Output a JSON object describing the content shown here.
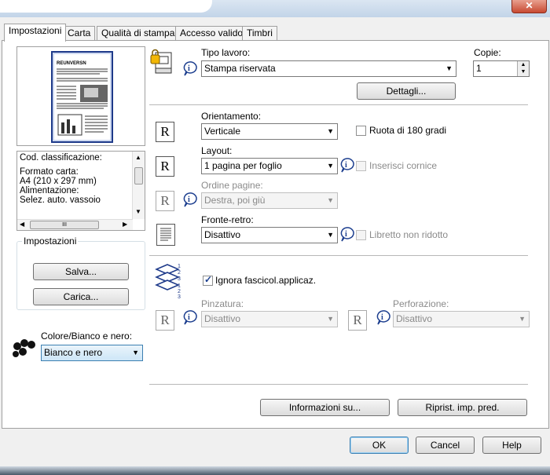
{
  "window": {
    "close_glyph": "✕"
  },
  "tabs": [
    {
      "label": "Impostazioni"
    },
    {
      "label": "Carta"
    },
    {
      "label": "Qualità di stampa"
    },
    {
      "label": "Accesso valido"
    },
    {
      "label": "Timbri"
    }
  ],
  "preview": {
    "doc_title": "REUNVERSN"
  },
  "summary": {
    "lines": [
      "Cod. classificazione:",
      "",
      "Formato carta:",
      " A4 (210 x 297 mm)",
      "Alimentazione:",
      " Selez. auto. vassoio"
    ],
    "scroll_middle": "III"
  },
  "settings_group": {
    "title": "Impostazioni",
    "save_label": "Salva...",
    "load_label": "Carica..."
  },
  "color": {
    "label": "Colore/Bianco e nero:",
    "value": "Bianco e nero"
  },
  "job": {
    "label": "Tipo lavoro:",
    "value": "Stampa riservata",
    "details_label": "Dettagli..."
  },
  "copies": {
    "label": "Copie:",
    "value": "1"
  },
  "orientation": {
    "label": "Orientamento:",
    "value": "Verticale",
    "rotate_label": "Ruota di 180 gradi",
    "rotate_checked": false
  },
  "layout": {
    "label": "Layout:",
    "value": "1 pagina per foglio",
    "frame_label": "Inserisci cornice"
  },
  "page_order": {
    "label": "Ordine pagine:",
    "value": "Destra, poi giù"
  },
  "duplex": {
    "label": "Fronte-retro:",
    "value": "Disattivo",
    "booklet_label": "Libretto non ridotto"
  },
  "collate": {
    "label": "Ignora fascicol.applicaz.",
    "checked": true
  },
  "staple": {
    "label": "Pinzatura:",
    "value": "Disattivo"
  },
  "punch": {
    "label": "Perforazione:",
    "value": "Disattivo"
  },
  "footer": {
    "info_label": "Informazioni su...",
    "reset_label": "Riprist. imp. pred."
  },
  "dialog_buttons": {
    "ok": "OK",
    "cancel": "Cancel",
    "help": "Help"
  },
  "icons": {
    "r_glyph": "R",
    "collate_digits": "1 2 3"
  }
}
